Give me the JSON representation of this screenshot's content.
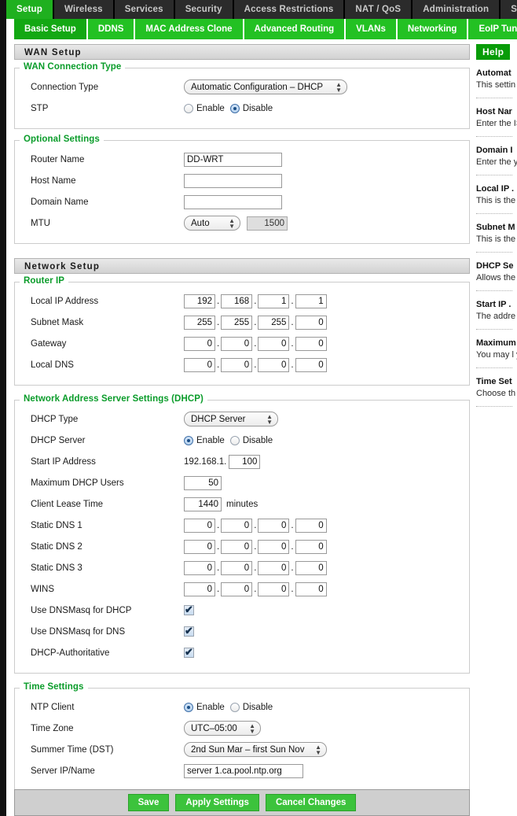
{
  "topnav": {
    "tabs": [
      {
        "label": "Setup",
        "active": true
      },
      {
        "label": "Wireless",
        "active": false
      },
      {
        "label": "Services",
        "active": false
      },
      {
        "label": "Security",
        "active": false
      },
      {
        "label": "Access Restrictions",
        "active": false
      },
      {
        "label": "NAT / QoS",
        "active": false
      },
      {
        "label": "Administration",
        "active": false
      },
      {
        "label": "Status",
        "active": false
      }
    ]
  },
  "subnav": {
    "tabs": [
      {
        "label": "Basic Setup",
        "active": true
      },
      {
        "label": "DDNS",
        "active": false
      },
      {
        "label": "MAC Address Clone",
        "active": false
      },
      {
        "label": "Advanced Routing",
        "active": false
      },
      {
        "label": "VLANs",
        "active": false
      },
      {
        "label": "Networking",
        "active": false
      },
      {
        "label": "EoIP Tunnel",
        "active": false
      }
    ]
  },
  "wan_setup": {
    "section_title": "WAN Setup",
    "connection_type_legend": "WAN Connection Type",
    "connection_type_label": "Connection Type",
    "connection_type_value": "Automatic Configuration – DHCP",
    "stp_label": "STP",
    "stp_enable_label": "Enable",
    "stp_disable_label": "Disable",
    "stp_selected": "Disable"
  },
  "optional_settings": {
    "legend": "Optional Settings",
    "router_name_label": "Router Name",
    "router_name_value": "DD-WRT",
    "host_name_label": "Host Name",
    "host_name_value": "",
    "domain_name_label": "Domain Name",
    "domain_name_value": "",
    "mtu_label": "MTU",
    "mtu_mode": "Auto",
    "mtu_value": "1500"
  },
  "network_setup": {
    "section_title": "Network Setup",
    "router_ip_legend": "Router IP",
    "local_ip_label": "Local IP Address",
    "local_ip": [
      "192",
      "168",
      "1",
      "1"
    ],
    "subnet_mask_label": "Subnet Mask",
    "subnet_mask": [
      "255",
      "255",
      "255",
      "0"
    ],
    "gateway_label": "Gateway",
    "gateway": [
      "0",
      "0",
      "0",
      "0"
    ],
    "local_dns_label": "Local DNS",
    "local_dns": [
      "0",
      "0",
      "0",
      "0"
    ]
  },
  "dhcp": {
    "legend": "Network Address Server Settings (DHCP)",
    "dhcp_type_label": "DHCP Type",
    "dhcp_type_value": "DHCP Server",
    "dhcp_server_label": "DHCP Server",
    "enable_label": "Enable",
    "disable_label": "Disable",
    "dhcp_server_selected": "Enable",
    "start_ip_label": "Start IP Address",
    "start_ip_prefix": "192.168.1.",
    "start_ip_value": "100",
    "max_users_label": "Maximum DHCP Users",
    "max_users_value": "50",
    "lease_time_label": "Client Lease Time",
    "lease_time_value": "1440",
    "lease_time_unit": "minutes",
    "static_dns1_label": "Static DNS 1",
    "static_dns1": [
      "0",
      "0",
      "0",
      "0"
    ],
    "static_dns2_label": "Static DNS 2",
    "static_dns2": [
      "0",
      "0",
      "0",
      "0"
    ],
    "static_dns3_label": "Static DNS 3",
    "static_dns3": [
      "0",
      "0",
      "0",
      "0"
    ],
    "wins_label": "WINS",
    "wins": [
      "0",
      "0",
      "0",
      "0"
    ],
    "dnsmasq_dhcp_label": "Use DNSMasq for DHCP",
    "dnsmasq_dhcp_checked": true,
    "dnsmasq_dns_label": "Use DNSMasq for DNS",
    "dnsmasq_dns_checked": true,
    "dhcp_authoritative_label": "DHCP-Authoritative",
    "dhcp_authoritative_checked": true
  },
  "time_settings": {
    "legend": "Time Settings",
    "ntp_client_label": "NTP Client",
    "enable_label": "Enable",
    "disable_label": "Disable",
    "ntp_selected": "Enable",
    "time_zone_label": "Time Zone",
    "time_zone_value": "UTC–05:00",
    "dst_label": "Summer Time (DST)",
    "dst_value": "2nd Sun Mar – first Sun Nov",
    "server_label": "Server IP/Name",
    "server_value": "server 1.ca.pool.ntp.org"
  },
  "help": {
    "title": "Help",
    "entries": [
      {
        "heading": "Automat",
        "body": "This settin\nCable ope"
      },
      {
        "heading": "Host Nar",
        "body": "Enter the\nISP."
      },
      {
        "heading": "Domain I",
        "body": "Enter the\nyour ISP."
      },
      {
        "heading": "Local IP .",
        "body": "This is the"
      },
      {
        "heading": "Subnet M",
        "body": "This is the"
      },
      {
        "heading": "DHCP Se",
        "body": "Allows the\naddresses"
      },
      {
        "heading": "Start IP .",
        "body": "The addre\nwith."
      },
      {
        "heading": "Maximum",
        "body": "You may l\nyour route\npredefine\nhanded ou"
      },
      {
        "heading": "Time Set",
        "body": "Choose th\nSummer T\ncan use lo"
      }
    ]
  },
  "footer": {
    "save_label": "Save",
    "apply_label": "Apply Settings",
    "cancel_label": "Cancel Changes"
  }
}
